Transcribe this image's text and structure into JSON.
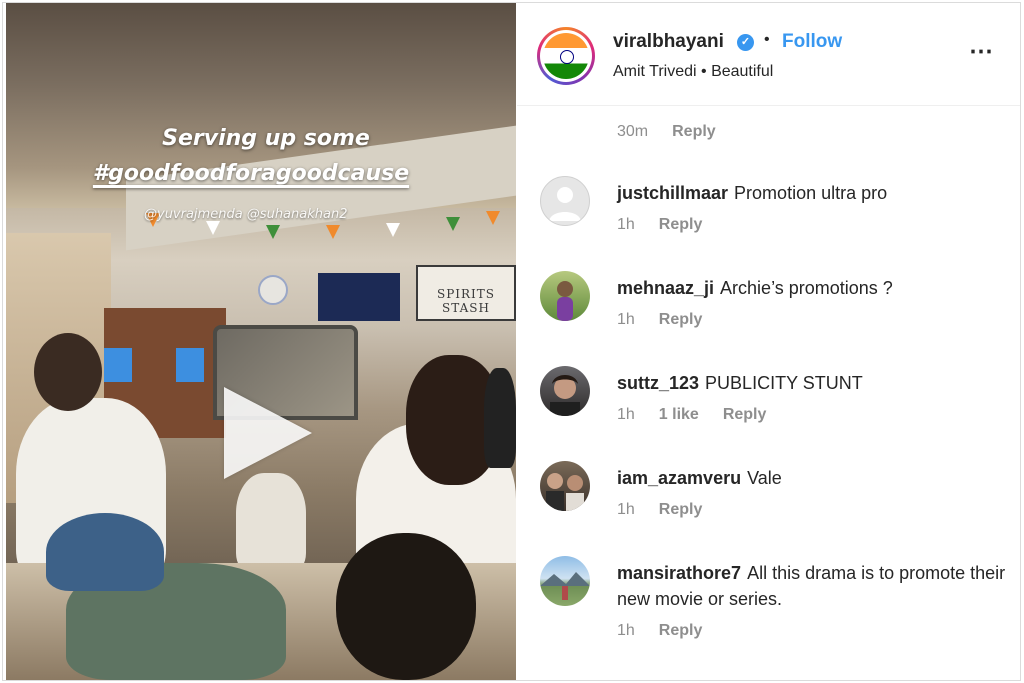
{
  "post": {
    "username": "viralbhayani",
    "follow_label": "Follow",
    "separator": "•",
    "audio": "Amit Trivedi • Beautiful",
    "more_icon": "⋯",
    "verified_icon": "✓"
  },
  "video": {
    "caption_line1": "Serving up some",
    "caption_line2": "#goodfoodforagoodcause",
    "tags": "@yuvrajmenda @suhanakhan2",
    "sign_text": "SPIRITS STASH"
  },
  "caption_meta": {
    "time": "30m",
    "reply_label": "Reply"
  },
  "comments": [
    {
      "username": "justchillmaar",
      "text": "Promotion ultra pro",
      "time": "1h",
      "likes": "",
      "reply_label": "Reply",
      "avatar_color": "#d9d9d9"
    },
    {
      "username": "mehnaaz_ji",
      "text": "Archie’s promotions ?",
      "time": "1h",
      "likes": "",
      "reply_label": "Reply",
      "avatar_color": "#6a8f3a"
    },
    {
      "username": "suttz_123",
      "text": "PUBLICITY STUNT",
      "time": "1h",
      "likes": "1 like",
      "reply_label": "Reply",
      "avatar_color": "#3b3330"
    },
    {
      "username": "iam_azamveru",
      "text": "Vale",
      "time": "1h",
      "likes": "",
      "reply_label": "Reply",
      "avatar_color": "#4d4338"
    },
    {
      "username": "mansirathore7",
      "text": "All this drama is to promote their new movie or series.",
      "time": "1h",
      "likes": "",
      "reply_label": "Reply",
      "avatar_color": "#7da7cc"
    }
  ]
}
